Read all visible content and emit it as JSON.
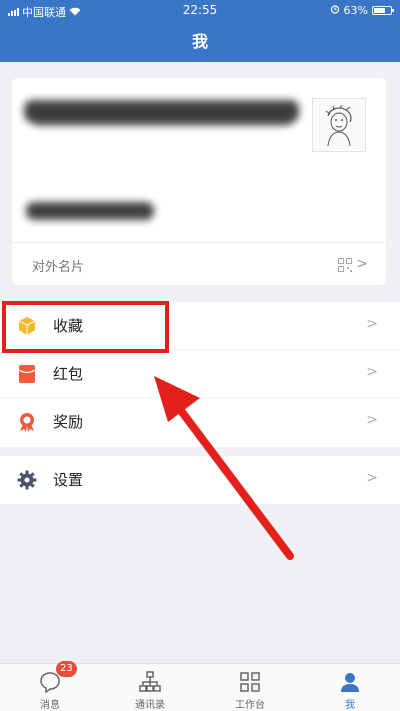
{
  "status_bar": {
    "carrier": "中国联通",
    "time": "22:55",
    "battery": "63%",
    "battery_level": 0.63
  },
  "header": {
    "title": "我"
  },
  "profile_card": {
    "footer_label": "对外名片",
    "qr_icon": "qr-code-icon"
  },
  "menu": {
    "group1": [
      {
        "label": "收藏",
        "icon": "favorites-box-icon",
        "color": "#f5b92c"
      },
      {
        "label": "红包",
        "icon": "red-envelope-icon",
        "color": "#f05a3c"
      },
      {
        "label": "奖励",
        "icon": "award-medal-icon",
        "color": "#f05a3c"
      }
    ],
    "group2": [
      {
        "label": "设置",
        "icon": "gear-icon",
        "color": "#4a5670"
      }
    ]
  },
  "annotation": {
    "color": "#e3211a"
  },
  "tab_bar": {
    "tabs": [
      {
        "label": "消息",
        "icon": "chat-bubble-icon",
        "badge": "23"
      },
      {
        "label": "通讯录",
        "icon": "org-chart-icon"
      },
      {
        "label": "工作台",
        "icon": "grid-apps-icon"
      },
      {
        "label": "我",
        "icon": "user-icon",
        "active": true
      }
    ],
    "active_color": "#3a76c8"
  }
}
